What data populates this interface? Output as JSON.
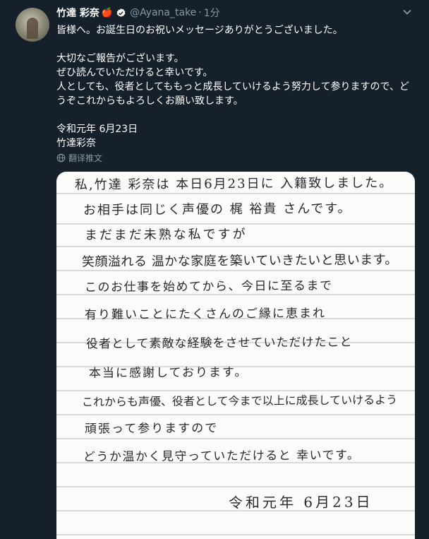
{
  "tweet": {
    "display_name": "竹達 彩奈",
    "name_emoji": "🍎",
    "handle": "@Ayana_take",
    "separator": "·",
    "time": "1分",
    "lines": [
      "皆様へ。お誕生日のお祝いメッセージありがとうございました。",
      "",
      "大切なご報告がございます。",
      "ぜひ読んでいただけると幸いです。",
      "人としても、役者としてももっと成長していけるよう努力して参りますので、ど",
      "うぞこれからもよろしくお願い致します。",
      "",
      "令和元年 6月23日",
      "竹達彩奈"
    ],
    "translate_label": "翻译推文"
  },
  "letter": {
    "lines": [
      "私,竹達 彩奈は 本日6月23日に 入籍致しました。",
      "お相手は同じく声優の 梶 裕貴 さんです。",
      "まだまだ未熟な私ですが",
      "笑顔溢れる 温かな家庭を築いていきたいと思います。",
      "このお仕事を始めてから、今日に至るまで",
      "有り難いことにたくさんのご縁に恵まれ",
      "役者として素敵な経験をさせていただけたこと",
      "本当に感謝しております。",
      "これからも声優、役者として今まで以上に成長していけるよう",
      "頑張って参りますので",
      "どうか温かく見守っていただけると 幸いです。",
      "令和元年 6月23日"
    ]
  },
  "colors": {
    "background": "#15202b",
    "secondary_text": "#8899a6",
    "verified": "#ffffff",
    "apple": "#e0245e",
    "paper": "#fbfbf9",
    "ruled_line": "#b9b9b9"
  },
  "icons": {
    "verified": "verified-badge-icon",
    "caret": "chevron-down-icon",
    "translate": "globe-icon"
  }
}
